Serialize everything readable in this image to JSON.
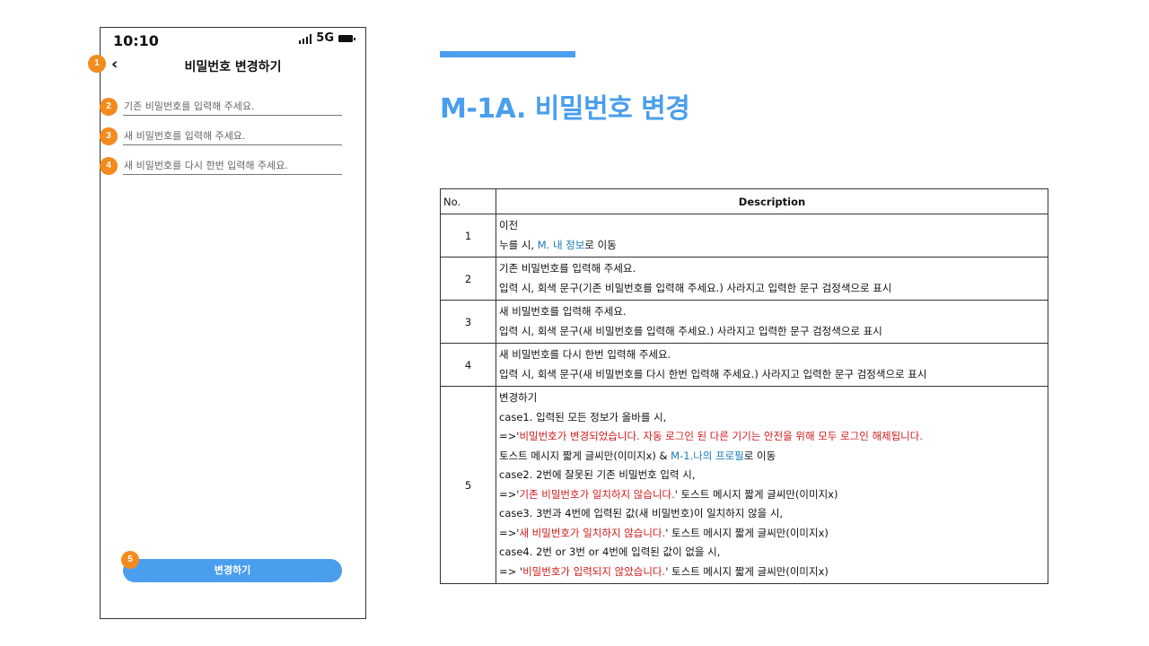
{
  "phone": {
    "status_time": "10:10",
    "network": "5G",
    "nav_title": "비밀번호 변경하기",
    "back_glyph": "‹",
    "fields": [
      {
        "placeholder": "기존 비밀번호를 입력해 주세요."
      },
      {
        "placeholder": "새 비밀번호를 입력해 주세요."
      },
      {
        "placeholder": "새 비밀번호를 다시 한번 입력해 주세요."
      }
    ],
    "button_label": "변경하기",
    "markers": [
      "1",
      "2",
      "3",
      "4",
      "5"
    ]
  },
  "header": {
    "title": "M-1A. 비밀번호 변경"
  },
  "colors": {
    "accent": "#4a9eee",
    "marker": "#f28c1e",
    "link": "#1a7ab5",
    "error": "#d11a1a"
  },
  "table": {
    "head": {
      "no": "No.",
      "description": "Description"
    },
    "rows": [
      {
        "no": "1",
        "title": "이전",
        "lines": [
          [
            {
              "t": "누를 시, "
            },
            {
              "t": "M. 내 정보",
              "c": "blue"
            },
            {
              "t": "로 이동"
            }
          ]
        ]
      },
      {
        "no": "2",
        "title": "기존 비밀번호를 입력해 주세요.",
        "lines": [
          [
            {
              "t": "입력 시, 회색 문구(기존 비밀번호를 입력해 주세요.) 사라지고 입력한 문구 검정색으로 표시"
            }
          ]
        ]
      },
      {
        "no": "3",
        "title": "새 비밀번호를 입력해 주세요.",
        "lines": [
          [
            {
              "t": "입력 시, 회색 문구(새 비밀번호를 입력해 주세요.) 사라지고 입력한 문구 검정색으로 표시"
            }
          ]
        ]
      },
      {
        "no": "4",
        "title": "새 비밀번호를 다시 한번 입력해 주세요.",
        "lines": [
          [
            {
              "t": "입력 시, 회색 문구(새 비밀번호를 다시 한번 입력해 주세요.) 사라지고 입력한 문구 검정색으로 표시"
            }
          ]
        ]
      },
      {
        "no": "5",
        "title": "변경하기",
        "lines": [
          [
            {
              "t": "case1. 입력된 모든 정보가 올바를 시,"
            }
          ],
          [
            {
              "t": "=>'"
            },
            {
              "t": "비밀번호가 변경되었습니다. 자동 로그인 된 다른 기기는 안전을 위해 모두 로그인 해제됩니다.",
              "c": "red"
            }
          ],
          [
            {
              "t": "토스트 메시지 짧게 글씨만(이미지x) & "
            },
            {
              "t": "M-1.나의 프로필",
              "c": "blue"
            },
            {
              "t": "로 이동"
            }
          ],
          [
            {
              "t": "case2. 2번에 잘못된 기존 비밀번호 입력 시,"
            }
          ],
          [
            {
              "t": "=>'"
            },
            {
              "t": "기존 비밀번호가 일치하지 않습니다.",
              "c": "red"
            },
            {
              "t": "' 토스트 메시지 짧게 글씨만(이미지x)"
            }
          ],
          [
            {
              "t": "case3. 3번과 4번에 입력된 값(새 비밀번호)이 일치하지 않을 시,"
            }
          ],
          [
            {
              "t": "=>'"
            },
            {
              "t": "새 비밀번호가 일치하지 않습니다.",
              "c": "red"
            },
            {
              "t": "' 토스트 메시지 짧게 글씨만(이미지x)"
            }
          ],
          [
            {
              "t": "case4. 2번 or 3번 or 4번에 입력된 값이 없을 시,"
            }
          ],
          [
            {
              "t": "=> '"
            },
            {
              "t": "비밀번호가 입력되지 않았습니다.",
              "c": "red"
            },
            {
              "t": "' 토스트 메시지 짧게 글씨만(이미지x)"
            }
          ]
        ]
      }
    ]
  }
}
